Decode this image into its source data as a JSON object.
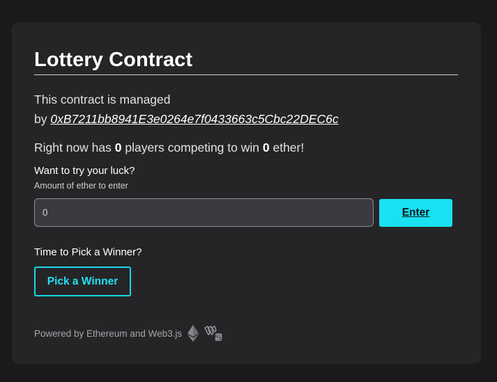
{
  "card": {
    "title": "Lottery Contract",
    "managed_prefix": "This contract is managed",
    "managed_by": "by",
    "manager_address": "0xB7211bb8941E3e0264e7f0433663c5Cbc22DEC6c",
    "status_prefix": "Right now has",
    "players_count": "0",
    "status_middle": "players competing to win",
    "prize_amount": "0",
    "status_suffix": "ether!"
  },
  "enter_form": {
    "heading": "Want to try your luck?",
    "amount_label": "Amount of ether to enter",
    "amount_value": "0",
    "enter_label": "Enter"
  },
  "pick_winner": {
    "heading": "Time to Pick a Winner?",
    "button_label": "Pick a Winner"
  },
  "footer": {
    "text": "Powered by Ethereum and Web3.js",
    "icons": [
      "ethereum-icon",
      "web3js-icon"
    ]
  },
  "colors": {
    "background": "#1a1a1c",
    "card": "#252527",
    "accent": "#19e1f2"
  }
}
